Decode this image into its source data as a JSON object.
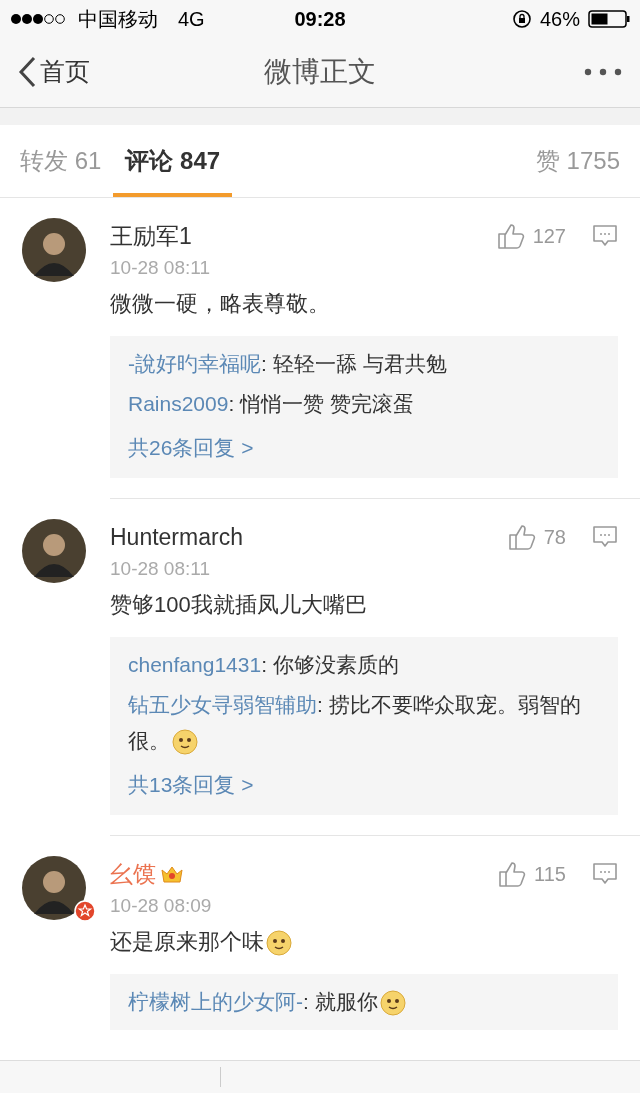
{
  "status_bar": {
    "carrier": "中国移动",
    "network": "4G",
    "time": "09:28",
    "battery": "46%"
  },
  "nav": {
    "back_label": "首页",
    "title": "微博正文"
  },
  "tabs": [
    {
      "label": "转发 61",
      "selected": false
    },
    {
      "label": "评论 847",
      "selected": true
    },
    {
      "label": "赞 1755",
      "selected": false
    }
  ],
  "comments": [
    {
      "user": "王励军1",
      "vip": false,
      "verified": false,
      "time": "10-28 08:11",
      "text": "微微一硬，略表尊敬。",
      "emoji": false,
      "likes": "127",
      "replies": [
        {
          "user": "-說好旳幸福呢",
          "text": ": 轻轻一舔  与君共勉",
          "emoji": false
        },
        {
          "user": "Rains2009",
          "text": ": 悄悄一赞 赞完滚蛋",
          "emoji": false
        }
      ],
      "more_replies": "共26条回复 >"
    },
    {
      "user": "Huntermarch",
      "vip": false,
      "verified": false,
      "time": "10-28 08:11",
      "text": "赞够100我就插凤儿大嘴巴",
      "emoji": false,
      "likes": "78",
      "replies": [
        {
          "user": "chenfang1431",
          "text": ": 你够没素质的",
          "emoji": false
        },
        {
          "user": "钻五少女寻弱智辅助",
          "text": ": 捞比不要哗众取宠。弱智的很。",
          "emoji": true
        }
      ],
      "more_replies": "共13条回复 >"
    },
    {
      "user": "幺馍",
      "vip": true,
      "verified": true,
      "time": "10-28 08:09",
      "text": "还是原来那个味",
      "emoji": true,
      "likes": "115",
      "replies": [
        {
          "user": "柠檬树上的少女阿-",
          "text": ": 就服你",
          "emoji": true
        }
      ]
    }
  ]
}
